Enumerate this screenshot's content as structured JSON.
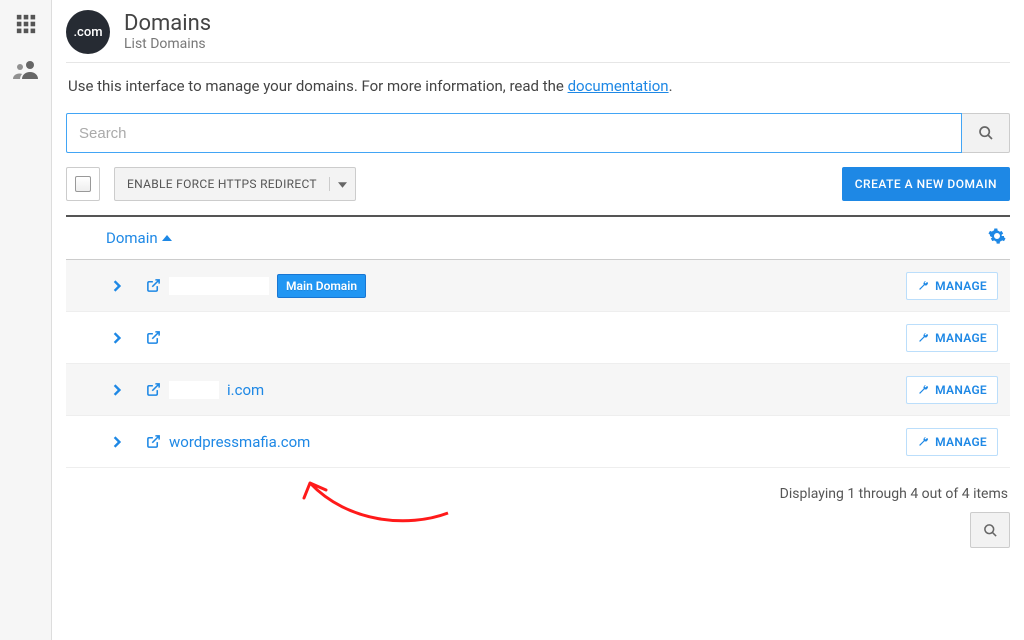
{
  "sidebar": {
    "items": [
      "apps-grid-icon",
      "users-icon"
    ]
  },
  "header": {
    "logo_text": ".com",
    "title": "Domains",
    "subtitle": "List Domains"
  },
  "intro": {
    "text_before": "Use this interface to manage your domains. For more information, read the ",
    "link_text": "documentation",
    "text_after": "."
  },
  "search": {
    "placeholder": "Search",
    "value": ""
  },
  "toolbar": {
    "force_https_label": "ENABLE FORCE HTTPS REDIRECT",
    "create_label": "CREATE A NEW DOMAIN"
  },
  "table": {
    "sort_column": "Domain",
    "badge_main": "Main Domain",
    "manage_label": "MANAGE",
    "rows": [
      {
        "name": "",
        "obscured": true,
        "main": true
      },
      {
        "name": "",
        "obscured": true,
        "main": false
      },
      {
        "name": "i.com",
        "obscured": true,
        "main": false
      },
      {
        "name": "wordpressmafia.com",
        "obscured": false,
        "main": false
      }
    ]
  },
  "footer": {
    "summary": "Displaying 1 through 4 out of 4 items"
  }
}
